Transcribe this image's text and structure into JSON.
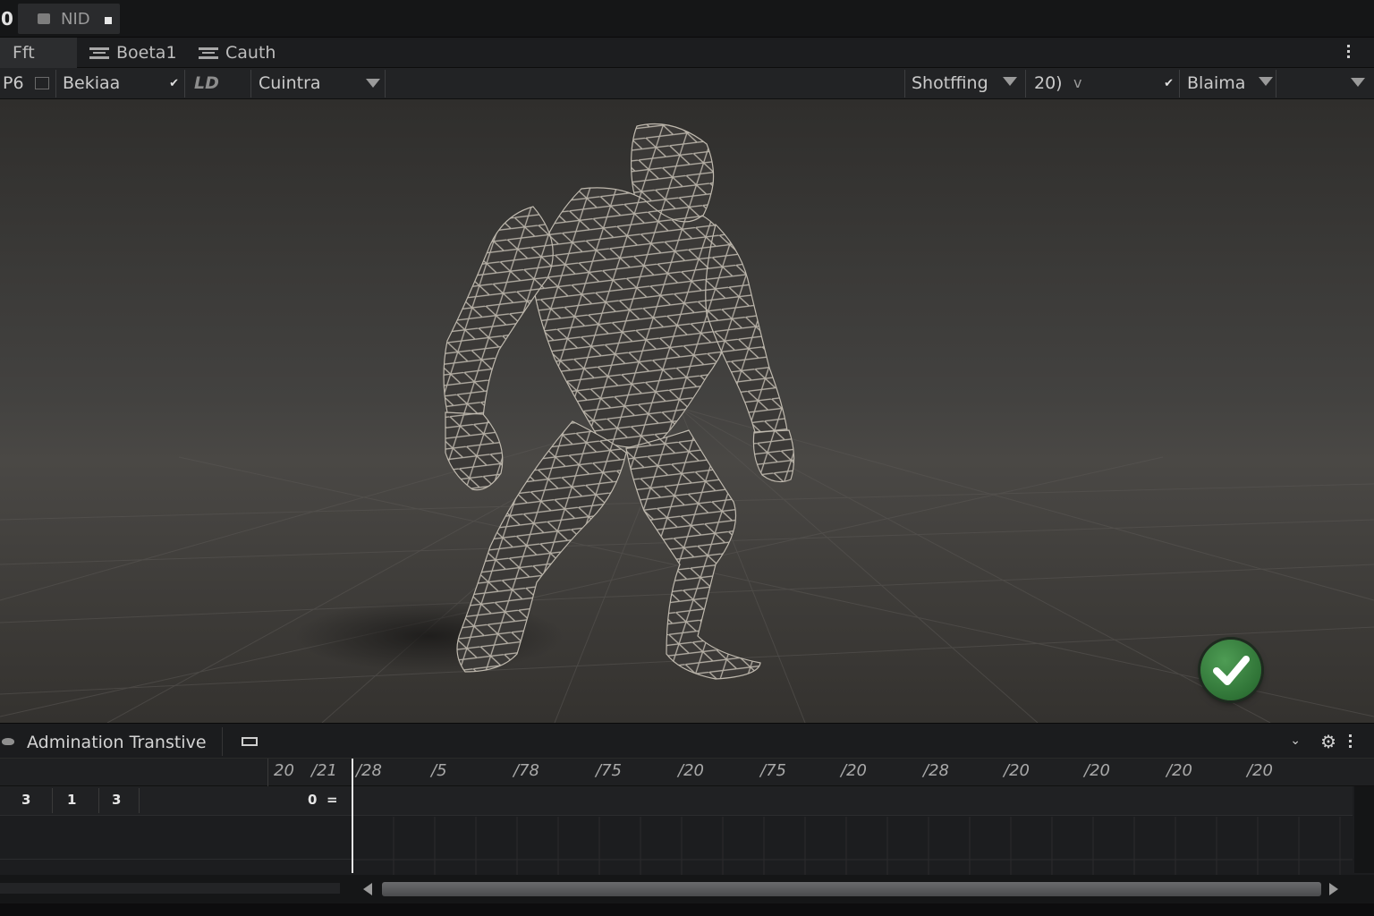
{
  "titlebar": {
    "left_label": "0",
    "tab_label": "NID"
  },
  "tabs": [
    {
      "label": "Fft",
      "active": true
    },
    {
      "label": "Boeta1",
      "icon": "layers-icon"
    },
    {
      "label": "Cauth",
      "icon": "layers-icon"
    }
  ],
  "toolbar": {
    "p6": "P6",
    "bekiaa": "Bekiaa",
    "ld": "LD",
    "cuintra": "Cuintra",
    "shotffing": "Shotffing",
    "value20": "20)",
    "blaima": "Blaima"
  },
  "viewport": {
    "subject": "wireframe-humanoid-model",
    "confirm_icon": "checkmark-icon",
    "confirm_color": "#3a8a43"
  },
  "animation": {
    "title": "Admination Transtive",
    "ruler_ticks": [
      "20",
      "/21",
      "/28",
      "/5",
      "/78",
      "/75",
      "/20",
      "/75",
      "/20",
      "/28",
      "/20",
      "/20",
      "/20",
      "/20"
    ],
    "track_values": [
      "3",
      "1",
      "3"
    ],
    "track_right_value": "0",
    "track_right_symbol": "="
  },
  "colors": {
    "accent_green": "#3a8a43",
    "background": "#111213"
  }
}
